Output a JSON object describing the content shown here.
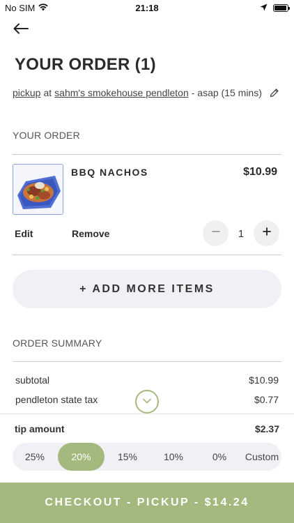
{
  "status_bar": {
    "carrier": "No SIM",
    "time": "21:18",
    "battery_level": 0.95
  },
  "header": {
    "title": "YOUR ORDER (1)"
  },
  "order_info": {
    "mode": "pickup",
    "connector": "at",
    "restaurant": "sahm's smokehouse pendleton",
    "timing": "- asap (15 mins)"
  },
  "order_section": {
    "label": "YOUR ORDER",
    "items": [
      {
        "name": "BBQ NACHOS",
        "price": "$10.99",
        "quantity": "1",
        "edit_label": "Edit",
        "remove_label": "Remove"
      }
    ]
  },
  "add_more_label": "+ ADD MORE ITEMS",
  "summary": {
    "label": "ORDER SUMMARY",
    "rows": [
      {
        "label": "subtotal",
        "value": "$10.99"
      },
      {
        "label": "pendleton state tax",
        "value": "$0.77"
      }
    ]
  },
  "tip": {
    "label": "tip amount",
    "amount": "$2.37",
    "options": [
      "25%",
      "20%",
      "15%",
      "10%",
      "0%",
      "Custom"
    ],
    "selected": "20%"
  },
  "checkout_label": "CHECKOUT - PICKUP - $14.24",
  "colors": {
    "accent": "#a3b97e",
    "pill_bg": "#f1f0f5",
    "text_dark": "#2b2b2b"
  },
  "icons": [
    "wifi-icon",
    "location-arrow-icon",
    "battery-icon",
    "back-arrow-icon",
    "pencil-icon",
    "minus-icon",
    "plus-icon",
    "chevron-down-icon"
  ]
}
